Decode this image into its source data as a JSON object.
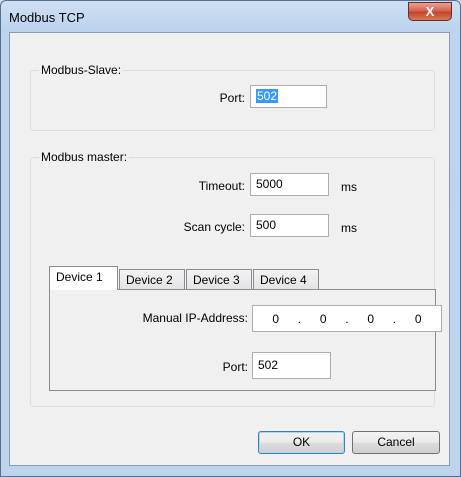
{
  "window": {
    "title": "Modbus TCP",
    "close_label": "X"
  },
  "slave": {
    "legend": "Modbus-Slave:",
    "port_label": "Port:",
    "port_value": "502"
  },
  "master": {
    "legend": "Modbus master:",
    "timeout_label": "Timeout:",
    "timeout_value": "5000",
    "timeout_unit": "ms",
    "scan_label": "Scan cycle:",
    "scan_value": "500",
    "scan_unit": "ms"
  },
  "tabs": [
    {
      "label": "Device 1"
    },
    {
      "label": "Device 2"
    },
    {
      "label": "Device 3"
    },
    {
      "label": "Device 4"
    }
  ],
  "device": {
    "ip_label": "Manual IP-Address:",
    "ip_octets": [
      "0",
      "0",
      "0",
      "0"
    ],
    "ip_sep": ".",
    "port_label": "Port:",
    "port_value": "502"
  },
  "buttons": {
    "ok": "OK",
    "cancel": "Cancel"
  }
}
